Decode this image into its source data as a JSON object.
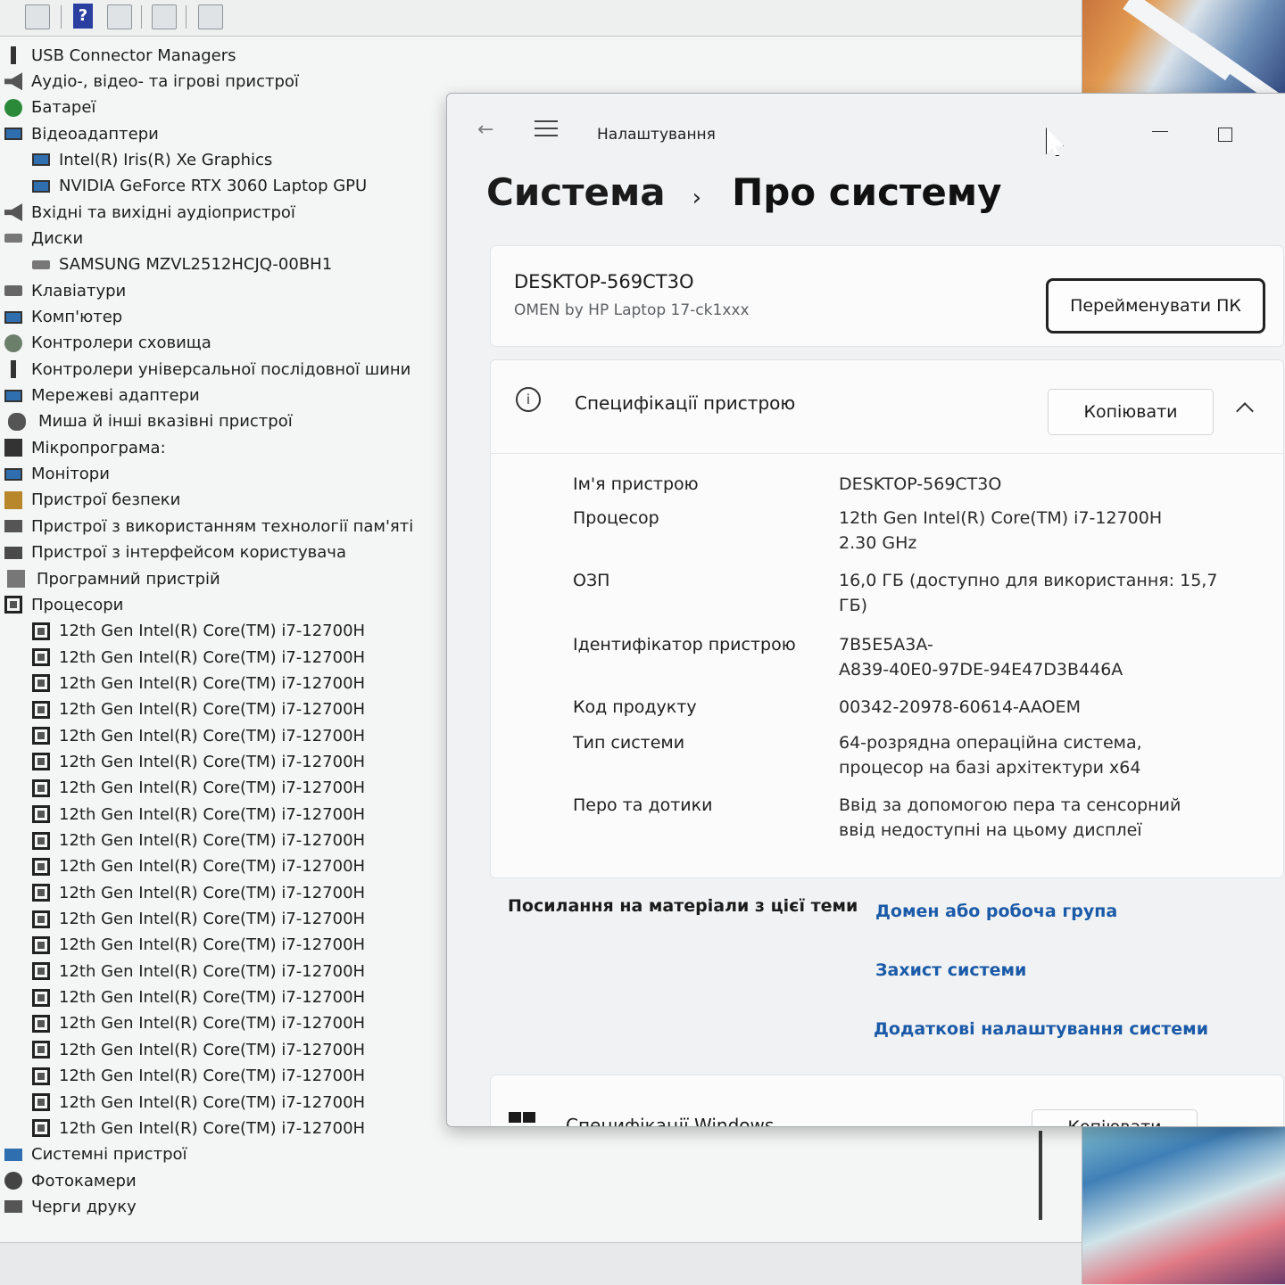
{
  "device_manager": {
    "toolbar_icons": [
      "properties-icon",
      "help-icon",
      "driver-icon",
      "scan-hardware-icon",
      "monitor-icon"
    ],
    "help_glyph": "?",
    "tree": [
      {
        "label": "USB Connector Managers",
        "icon": "plug-icon",
        "indent": 0
      },
      {
        "label": "Аудіо-, відео- та ігрові пристрої",
        "icon": "speaker-icon",
        "indent": 0
      },
      {
        "label": "Батареї",
        "icon": "battery-icon",
        "indent": 0
      },
      {
        "label": "Відеоадаптери",
        "icon": "monitor-icon",
        "indent": 0
      },
      {
        "label": "Intel(R) Iris(R) Xe Graphics",
        "icon": "monitor-icon",
        "indent": 1
      },
      {
        "label": "NVIDIA GeForce RTX 3060 Laptop GPU",
        "icon": "monitor-icon",
        "indent": 1
      },
      {
        "label": "Вхідні та вихідні аудіопристрої",
        "icon": "speaker-icon",
        "indent": 0
      },
      {
        "label": "Диски",
        "icon": "disk-icon",
        "indent": 0
      },
      {
        "label": "SAMSUNG MZVL2512HCJQ-00BH1",
        "icon": "disk-icon",
        "indent": 1
      },
      {
        "label": "Клавіатури",
        "icon": "keyboard-icon",
        "indent": 0
      },
      {
        "label": "Комп'ютер",
        "icon": "monitor-icon",
        "indent": 0
      },
      {
        "label": "Контролери сховища",
        "icon": "gear-icon",
        "indent": 0
      },
      {
        "label": "Контролери універсальної послідовної шини",
        "icon": "plug-icon",
        "indent": 0
      },
      {
        "label": "Мережеві адаптери",
        "icon": "monitor-icon",
        "indent": 0
      },
      {
        "label": "Миша й інші вказівні пристрої",
        "icon": "mouse-icon",
        "indent": 0
      },
      {
        "label": "Мікропрограма:",
        "icon": "chip-icon",
        "indent": 0
      },
      {
        "label": "Монітори",
        "icon": "monitor-icon",
        "indent": 0
      },
      {
        "label": "Пристрої безпеки",
        "icon": "lock-icon",
        "indent": 0
      },
      {
        "label": "Пристрої з використанням технології пам'яті",
        "icon": "memory-icon",
        "indent": 0
      },
      {
        "label": "Пристрої з інтерфейсом користувача",
        "icon": "hid-icon",
        "indent": 0
      },
      {
        "label": "Програмний пристрій",
        "icon": "software-device-icon",
        "indent": 0
      },
      {
        "label": "Процесори",
        "icon": "cpu-icon",
        "indent": 0
      },
      {
        "label": "12th Gen Intel(R) Core(TM) i7-12700H",
        "icon": "cpu-icon",
        "indent": 1
      },
      {
        "label": "12th Gen Intel(R) Core(TM) i7-12700H",
        "icon": "cpu-icon",
        "indent": 1
      },
      {
        "label": "12th Gen Intel(R) Core(TM) i7-12700H",
        "icon": "cpu-icon",
        "indent": 1
      },
      {
        "label": "12th Gen Intel(R) Core(TM) i7-12700H",
        "icon": "cpu-icon",
        "indent": 1
      },
      {
        "label": "12th Gen Intel(R) Core(TM) i7-12700H",
        "icon": "cpu-icon",
        "indent": 1
      },
      {
        "label": "12th Gen Intel(R) Core(TM) i7-12700H",
        "icon": "cpu-icon",
        "indent": 1
      },
      {
        "label": "12th Gen Intel(R) Core(TM) i7-12700H",
        "icon": "cpu-icon",
        "indent": 1
      },
      {
        "label": "12th Gen Intel(R) Core(TM) i7-12700H",
        "icon": "cpu-icon",
        "indent": 1
      },
      {
        "label": "12th Gen Intel(R) Core(TM) i7-12700H",
        "icon": "cpu-icon",
        "indent": 1
      },
      {
        "label": "12th Gen Intel(R) Core(TM) i7-12700H",
        "icon": "cpu-icon",
        "indent": 1
      },
      {
        "label": "12th Gen Intel(R) Core(TM) i7-12700H",
        "icon": "cpu-icon",
        "indent": 1
      },
      {
        "label": "12th Gen Intel(R) Core(TM) i7-12700H",
        "icon": "cpu-icon",
        "indent": 1
      },
      {
        "label": "12th Gen Intel(R) Core(TM) i7-12700H",
        "icon": "cpu-icon",
        "indent": 1
      },
      {
        "label": "12th Gen Intel(R) Core(TM) i7-12700H",
        "icon": "cpu-icon",
        "indent": 1
      },
      {
        "label": "12th Gen Intel(R) Core(TM) i7-12700H",
        "icon": "cpu-icon",
        "indent": 1
      },
      {
        "label": "12th Gen Intel(R) Core(TM) i7-12700H",
        "icon": "cpu-icon",
        "indent": 1
      },
      {
        "label": "12th Gen Intel(R) Core(TM) i7-12700H",
        "icon": "cpu-icon",
        "indent": 1
      },
      {
        "label": "12th Gen Intel(R) Core(TM) i7-12700H",
        "icon": "cpu-icon",
        "indent": 1
      },
      {
        "label": "12th Gen Intel(R) Core(TM) i7-12700H",
        "icon": "cpu-icon",
        "indent": 1
      },
      {
        "label": "12th Gen Intel(R) Core(TM) i7-12700H",
        "icon": "cpu-icon",
        "indent": 1
      },
      {
        "label": "Системні пристрої",
        "icon": "folder-icon",
        "indent": 0
      },
      {
        "label": "Фотокамери",
        "icon": "camera-icon",
        "indent": 0
      },
      {
        "label": "Черги друку",
        "icon": "printer-icon",
        "indent": 0
      }
    ]
  },
  "settings": {
    "app_title": "Налаштування",
    "breadcrumb": {
      "parent": "Система",
      "separator": "›",
      "current": "Про систему"
    },
    "pc": {
      "name": "DESKTOP-569CT3O",
      "model": "OMEN by HP Laptop 17-ck1xxx",
      "rename_label": "Перейменувати ПК"
    },
    "specs": {
      "title": "Специфікації пристрою",
      "copy_label": "Копіювати",
      "rows": [
        {
          "label": "Ім'я пристрою",
          "value": "DESKTOP-569CT3O"
        },
        {
          "label": "Процесор",
          "value": "12th Gen Intel(R) Core(TM) i7-12700H\n2.30 GHz"
        },
        {
          "label": "ОЗП",
          "value": "16,0 ГБ (доступно для використання: 15,7\nГБ)"
        },
        {
          "label": "Ідентифікатор пристрою",
          "value": "7B5E5A3A-\nA839-40E0-97DE-94E47D3B446A"
        },
        {
          "label": "Код продукту",
          "value": "00342-20978-60614-AAOEM"
        },
        {
          "label": "Тип системи",
          "value": "64-розрядна операційна система,\nпроцесор на базі архітектури x64"
        },
        {
          "label": "Перо та дотики",
          "value": "Ввід за допомогою пера та сенсорний\nввід недоступні на цьому дисплеї"
        }
      ]
    },
    "related": {
      "title": "Посилання на матеріали з цієї теми",
      "links": [
        "Домен або робоча група",
        "Захист системи",
        "Додаткові налаштування системи"
      ]
    },
    "windows_specs": {
      "title": "Специфікації Windows",
      "copy_label": "Копіювати"
    },
    "link_color": "#1a5aa8"
  }
}
